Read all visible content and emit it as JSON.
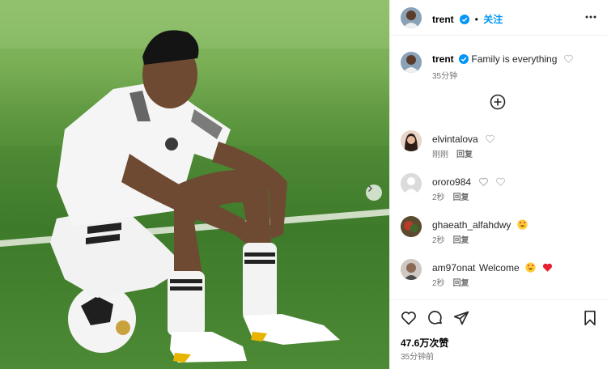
{
  "post": {
    "author": "trent",
    "follow_label": "关注",
    "caption_author": "trent",
    "caption_text": "Family is everything",
    "caption_time": "35分钟",
    "likes": "47.6万次赞",
    "posted_ago": "35分钟前"
  },
  "comments": [
    {
      "user": "elvintalova",
      "text": "",
      "time": "刚刚",
      "reply": "回复"
    },
    {
      "user": "ororo984",
      "text": "",
      "time": "2秒",
      "reply": "回复"
    },
    {
      "user": "ghaeath_alfahdwy",
      "text": "",
      "time": "2秒",
      "reply": "回复"
    },
    {
      "user": "am97onat",
      "text": "Welcome",
      "time": "2秒",
      "reply": "回复"
    }
  ],
  "colors": {
    "accent": "#0095f6",
    "grass": "#4f8a35",
    "meta": "#737373"
  }
}
